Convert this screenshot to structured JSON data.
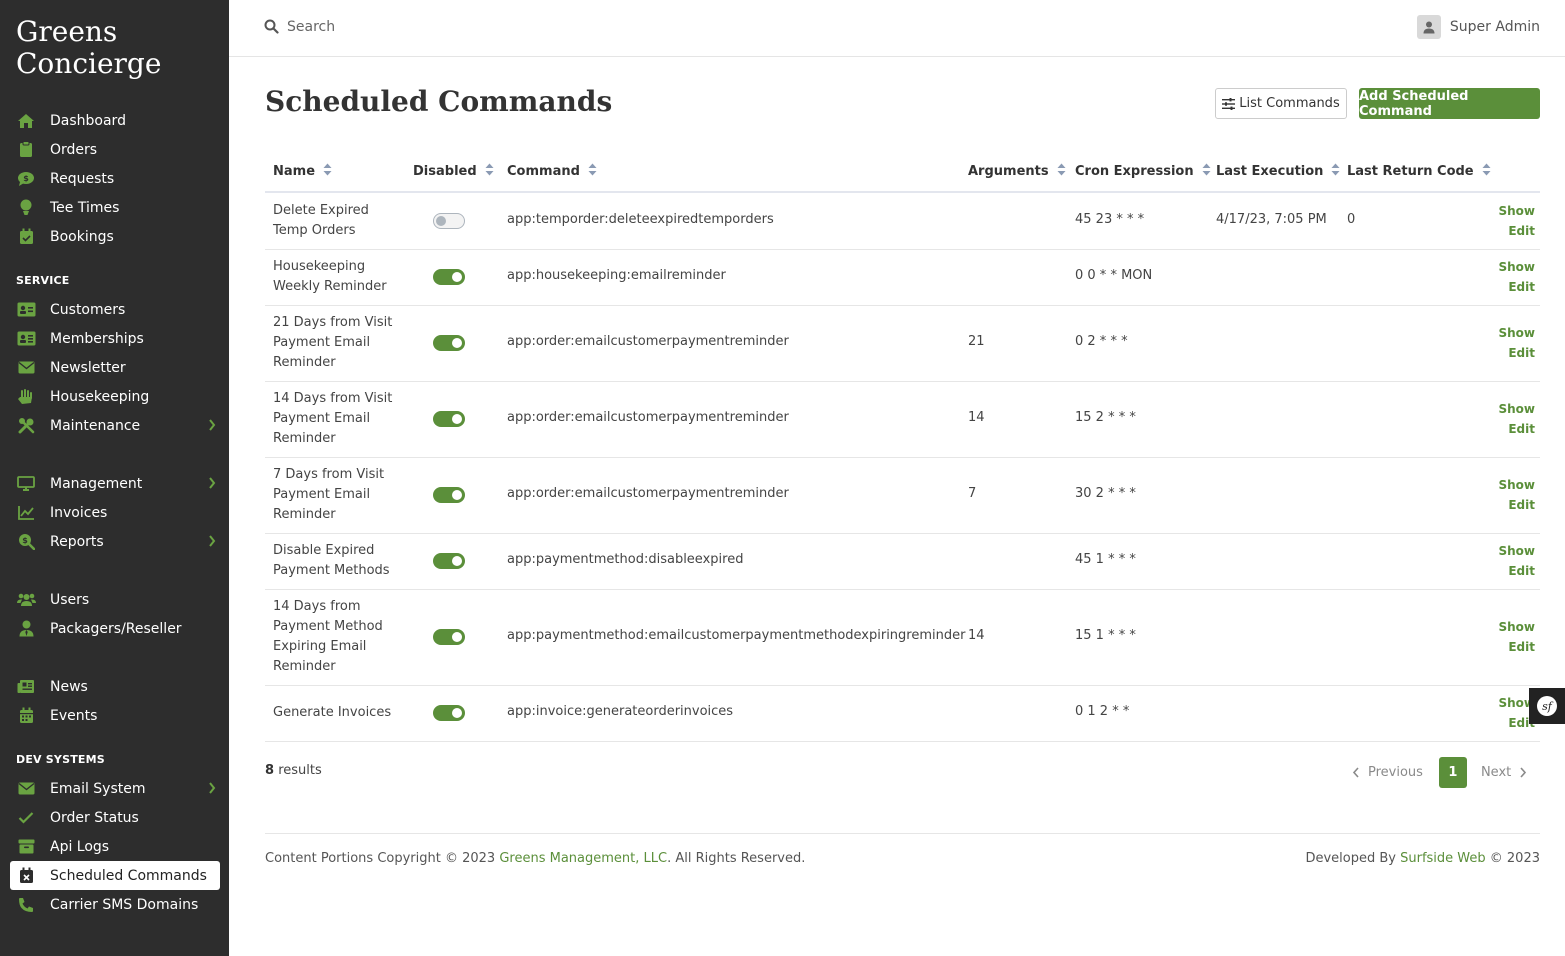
{
  "brand": {
    "line1": "Greens",
    "line2": "Concierge"
  },
  "sidebar": {
    "main_items": [
      {
        "label": "Dashboard",
        "icon": "home-icon"
      },
      {
        "label": "Orders",
        "icon": "clipboard-icon"
      },
      {
        "label": "Requests",
        "icon": "comment-dollar-icon"
      },
      {
        "label": "Tee Times",
        "icon": "golf-ball-icon"
      },
      {
        "label": "Bookings",
        "icon": "calendar-check-icon"
      }
    ],
    "service_label": "SERVICE",
    "service_items": [
      {
        "label": "Customers",
        "icon": "id-card-icon"
      },
      {
        "label": "Memberships",
        "icon": "address-card-icon"
      },
      {
        "label": "Newsletter",
        "icon": "envelope-icon"
      },
      {
        "label": "Housekeeping",
        "icon": "hands-wash-icon"
      },
      {
        "label": "Maintenance",
        "icon": "tools-icon"
      }
    ],
    "management_items": [
      {
        "label": "Management",
        "icon": "desktop-icon"
      },
      {
        "label": "Invoices",
        "icon": "chart-line-icon"
      },
      {
        "label": "Reports",
        "icon": "search-dollar-icon"
      }
    ],
    "user_items": [
      {
        "label": "Users",
        "icon": "users-icon"
      },
      {
        "label": "Packagers/Reseller",
        "icon": "user-tie-icon"
      }
    ],
    "news_items": [
      {
        "label": "News",
        "icon": "newspaper-icon"
      },
      {
        "label": "Events",
        "icon": "calendar-icon"
      }
    ],
    "dev_label": "DEV SYSTEMS",
    "dev_items": [
      {
        "label": "Email System",
        "icon": "envelope-icon"
      },
      {
        "label": "Order Status",
        "icon": "check-icon"
      },
      {
        "label": "Api Logs",
        "icon": "archive-icon"
      },
      {
        "label": "Scheduled Commands",
        "icon": "calendar-times-icon"
      },
      {
        "label": "Carrier SMS Domains",
        "icon": "phone-icon"
      }
    ]
  },
  "topbar": {
    "search_placeholder": "Search",
    "user_name": "Super Admin"
  },
  "page": {
    "title": "Scheduled Commands",
    "list_button": "List Commands",
    "add_button": "Add Scheduled Command"
  },
  "table": {
    "headers": [
      "Name",
      "Disabled",
      "Command",
      "Arguments",
      "Cron Expression",
      "Last Execution",
      "Last Return Code"
    ],
    "rows": [
      {
        "name": "Delete Expired Temp Orders",
        "disabled": false,
        "command": "app:temporder:deleteexpiredtemporders",
        "arguments": "",
        "cron": "45 23 * * *",
        "last_execution": "4/17/23, 7:05 PM",
        "return_code": "0"
      },
      {
        "name": "Housekeeping Weekly Reminder",
        "disabled": true,
        "command": "app:housekeeping:emailreminder",
        "arguments": "",
        "cron": "0 0 * * MON",
        "last_execution": "",
        "return_code": ""
      },
      {
        "name": "21 Days from Visit Payment Email Reminder",
        "disabled": true,
        "command": "app:order:emailcustomerpaymentreminder",
        "arguments": "21",
        "cron": "0 2 * * *",
        "last_execution": "",
        "return_code": ""
      },
      {
        "name": "14 Days from Visit Payment Email Reminder",
        "disabled": true,
        "command": "app:order:emailcustomerpaymentreminder",
        "arguments": "14",
        "cron": "15 2 * * *",
        "last_execution": "",
        "return_code": ""
      },
      {
        "name": "7 Days from Visit Payment Email Reminder",
        "disabled": true,
        "command": "app:order:emailcustomerpaymentreminder",
        "arguments": "7",
        "cron": "30 2 * * *",
        "last_execution": "",
        "return_code": ""
      },
      {
        "name": "Disable Expired Payment Methods",
        "disabled": true,
        "command": "app:paymentmethod:disableexpired",
        "arguments": "",
        "cron": "45 1 * * *",
        "last_execution": "",
        "return_code": ""
      },
      {
        "name": "14 Days from Payment Method Expiring Email Reminder",
        "disabled": true,
        "command": "app:paymentmethod:emailcustomerpaymentmethodexpiringreminder",
        "arguments": "14",
        "cron": "15 1 * * *",
        "last_execution": "",
        "return_code": ""
      },
      {
        "name": "Generate Invoices",
        "disabled": true,
        "command": "app:invoice:generateorderinvoices",
        "arguments": "",
        "cron": "0 1 2 * *",
        "last_execution": "",
        "return_code": ""
      }
    ],
    "show_label": "Show",
    "edit_label": "Edit"
  },
  "pagination": {
    "count": "8",
    "results_label": "results",
    "previous": "Previous",
    "current_page": "1",
    "next": "Next"
  },
  "footer": {
    "left_prefix": "Content Portions Copyright © 2023 ",
    "left_link": "Greens Management, LLC",
    "left_suffix": ". All Rights Reserved.",
    "right_prefix": "Developed By ",
    "right_link": "Surfside Web",
    "right_suffix": " © 2023"
  },
  "colors": {
    "sidebar_bg": "#2d2d2d",
    "accent": "#5b8f3a",
    "icon_green": "#6aa342"
  }
}
